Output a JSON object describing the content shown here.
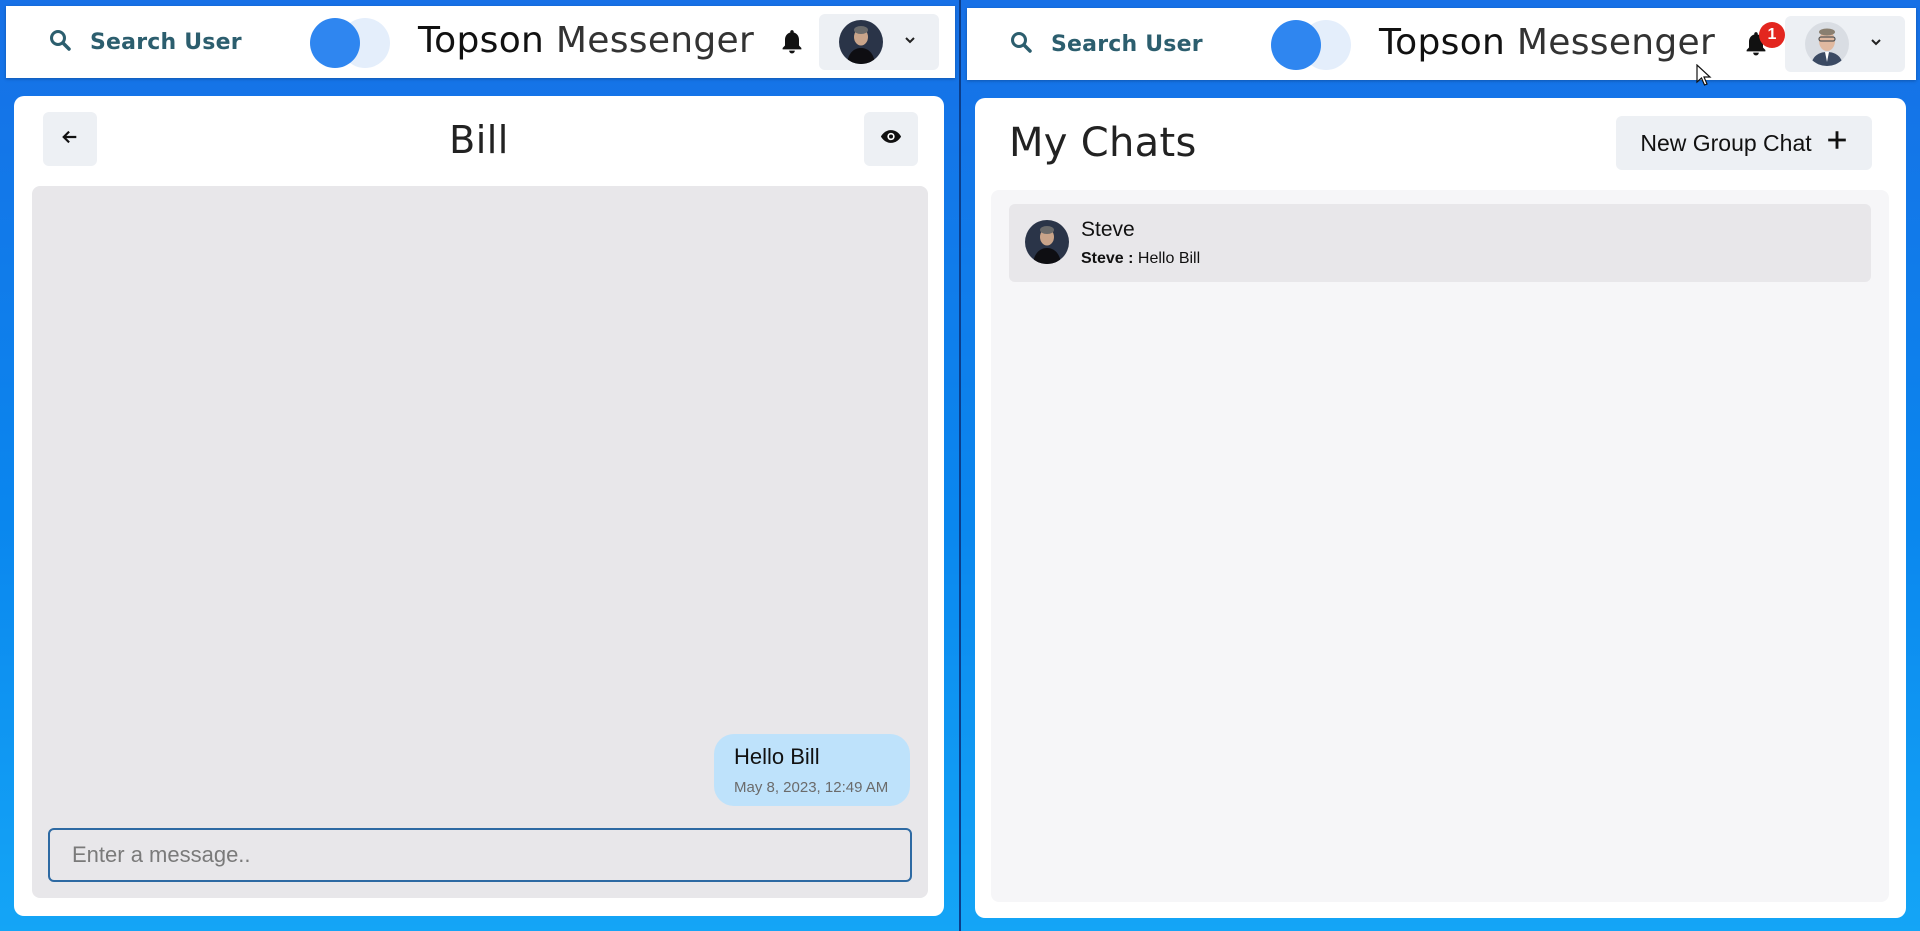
{
  "left_window": {
    "header": {
      "search_label": "Search User",
      "brand_first": "Topson",
      "brand_second": "Messenger",
      "notification_count": null
    },
    "chat": {
      "name": "Bill",
      "messages": [
        {
          "text": "Hello Bill",
          "timestamp": "May 8, 2023, 12:49 AM",
          "sender": "self"
        }
      ],
      "input_placeholder": "Enter a message.."
    }
  },
  "right_window": {
    "header": {
      "search_label": "Search User",
      "brand_first": "Topson",
      "brand_second": "Messenger",
      "notification_count": "1"
    },
    "my_chats": {
      "title": "My Chats",
      "new_group_label": "New Group Chat",
      "chats": [
        {
          "name": "Steve",
          "last_sender": "Steve :",
          "last_message": "Hello Bill"
        }
      ]
    }
  },
  "colors": {
    "accent": "#2f86f0",
    "bubble": "#bee2fb",
    "badge": "#e3261f",
    "background_gradient_top": "#1770e6",
    "background_gradient_bottom": "#14a5f6"
  }
}
